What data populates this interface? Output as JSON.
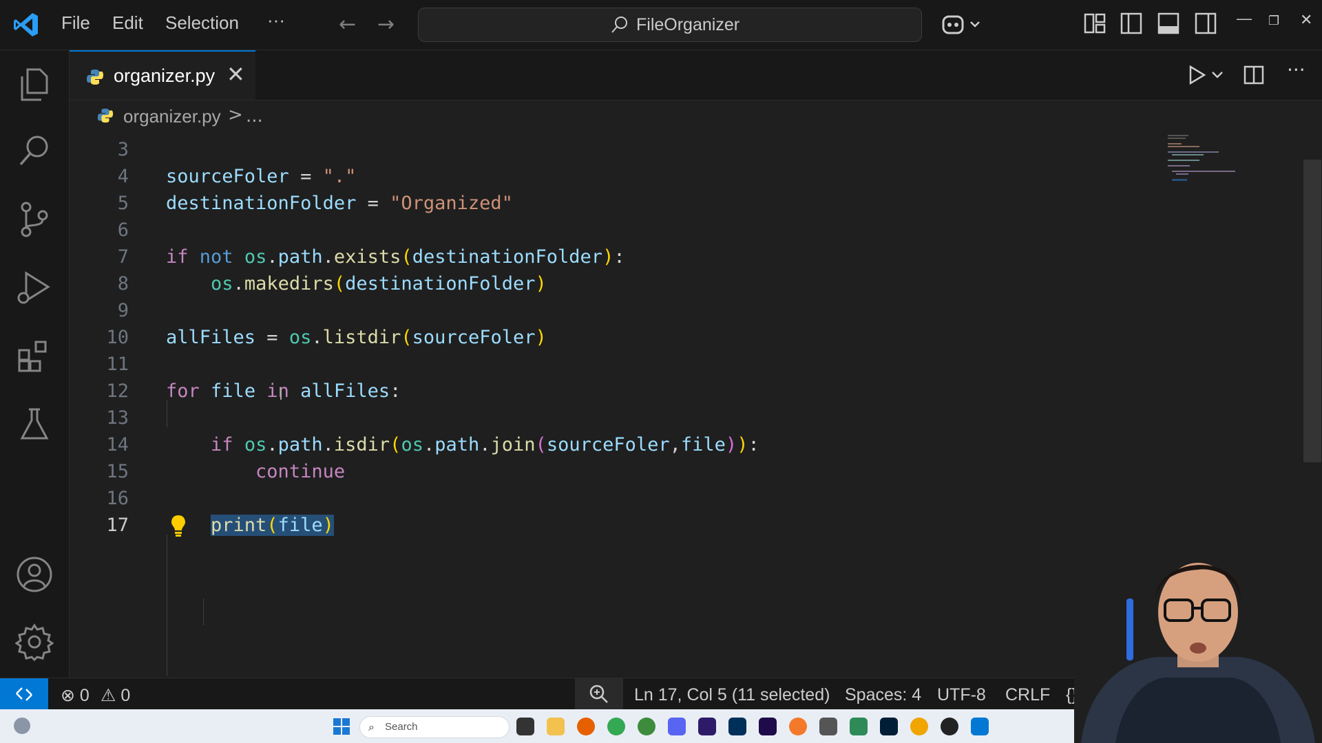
{
  "menu": {
    "file": "File",
    "edit": "Edit",
    "selection": "Selection",
    "more": "···"
  },
  "command_center": {
    "text": "FileOrganizer"
  },
  "tab": {
    "label": "organizer.py",
    "close": "✕"
  },
  "breadcrumbs": {
    "file": "organizer.py",
    "separator": ">",
    "more": "..."
  },
  "editor": {
    "lines": [
      {
        "n": "3",
        "segs": []
      },
      {
        "n": "4",
        "segs": [
          [
            "var",
            "sourceFoler"
          ],
          [
            "op",
            " = "
          ],
          [
            "str",
            "\".\""
          ]
        ]
      },
      {
        "n": "5",
        "segs": [
          [
            "var",
            "destinationFolder"
          ],
          [
            "op",
            " = "
          ],
          [
            "str",
            "\"Organized\""
          ]
        ]
      },
      {
        "n": "6",
        "segs": []
      },
      {
        "n": "7",
        "segs": [
          [
            "kw",
            "if"
          ],
          [
            "op",
            " "
          ],
          [
            "kw2",
            "not"
          ],
          [
            "op",
            " "
          ],
          [
            "mod",
            "os"
          ],
          [
            "op",
            "."
          ],
          [
            "var",
            "path"
          ],
          [
            "op",
            "."
          ],
          [
            "fn",
            "exists"
          ],
          [
            "p1",
            "("
          ],
          [
            "var",
            "destinationFolder"
          ],
          [
            "p1",
            ")"
          ],
          [
            "op",
            ":"
          ]
        ]
      },
      {
        "n": "8",
        "segs": [
          [
            "op",
            "    "
          ],
          [
            "mod",
            "os"
          ],
          [
            "op",
            "."
          ],
          [
            "fn",
            "makedirs"
          ],
          [
            "p1",
            "("
          ],
          [
            "var",
            "destinationFolder"
          ],
          [
            "p1",
            ")"
          ]
        ]
      },
      {
        "n": "9",
        "segs": []
      },
      {
        "n": "10",
        "segs": [
          [
            "var",
            "allFiles"
          ],
          [
            "op",
            " = "
          ],
          [
            "mod",
            "os"
          ],
          [
            "op",
            "."
          ],
          [
            "fn",
            "listdir"
          ],
          [
            "p1",
            "("
          ],
          [
            "var",
            "sourceFoler"
          ],
          [
            "p1",
            ")"
          ]
        ]
      },
      {
        "n": "11",
        "segs": []
      },
      {
        "n": "12",
        "segs": [
          [
            "kw",
            "for"
          ],
          [
            "op",
            " "
          ],
          [
            "var",
            "file"
          ],
          [
            "op",
            " "
          ],
          [
            "kw",
            "in"
          ],
          [
            "op",
            " "
          ],
          [
            "var",
            "allFiles"
          ],
          [
            "op",
            ":"
          ]
        ]
      },
      {
        "n": "13",
        "segs": []
      },
      {
        "n": "14",
        "segs": [
          [
            "op",
            "    "
          ],
          [
            "kw",
            "if"
          ],
          [
            "op",
            " "
          ],
          [
            "mod",
            "os"
          ],
          [
            "op",
            "."
          ],
          [
            "var",
            "path"
          ],
          [
            "op",
            "."
          ],
          [
            "fn",
            "isdir"
          ],
          [
            "p1",
            "("
          ],
          [
            "mod",
            "os"
          ],
          [
            "op",
            "."
          ],
          [
            "var",
            "path"
          ],
          [
            "op",
            "."
          ],
          [
            "fn",
            "join"
          ],
          [
            "p2",
            "("
          ],
          [
            "var",
            "sourceFoler"
          ],
          [
            "op",
            ","
          ],
          [
            "var",
            "file"
          ],
          [
            "p2",
            ")"
          ],
          [
            "p1",
            ")"
          ],
          [
            "op",
            ":"
          ]
        ]
      },
      {
        "n": "15",
        "segs": [
          [
            "op",
            "        "
          ],
          [
            "kw",
            "continue"
          ]
        ]
      },
      {
        "n": "16",
        "segs": []
      },
      {
        "n": "17",
        "segs": [
          [
            "op",
            "    "
          ],
          [
            "fn sel",
            "print"
          ],
          [
            "p1 sel",
            "("
          ],
          [
            "var sel",
            "file"
          ],
          [
            "p1 sel",
            ")"
          ]
        ]
      }
    ],
    "active_line": "17"
  },
  "status": {
    "errors": "0",
    "warnings": "0",
    "position": "Ln 17, Col 5 (11 selected)",
    "spaces": "Spaces: 4",
    "encoding": "UTF-8",
    "eol": "CRLF",
    "lang_braces": "{}"
  },
  "taskbar": {
    "search_placeholder": "Search"
  },
  "colors": {
    "accent": "#0078d4",
    "selection": "#264f78"
  }
}
